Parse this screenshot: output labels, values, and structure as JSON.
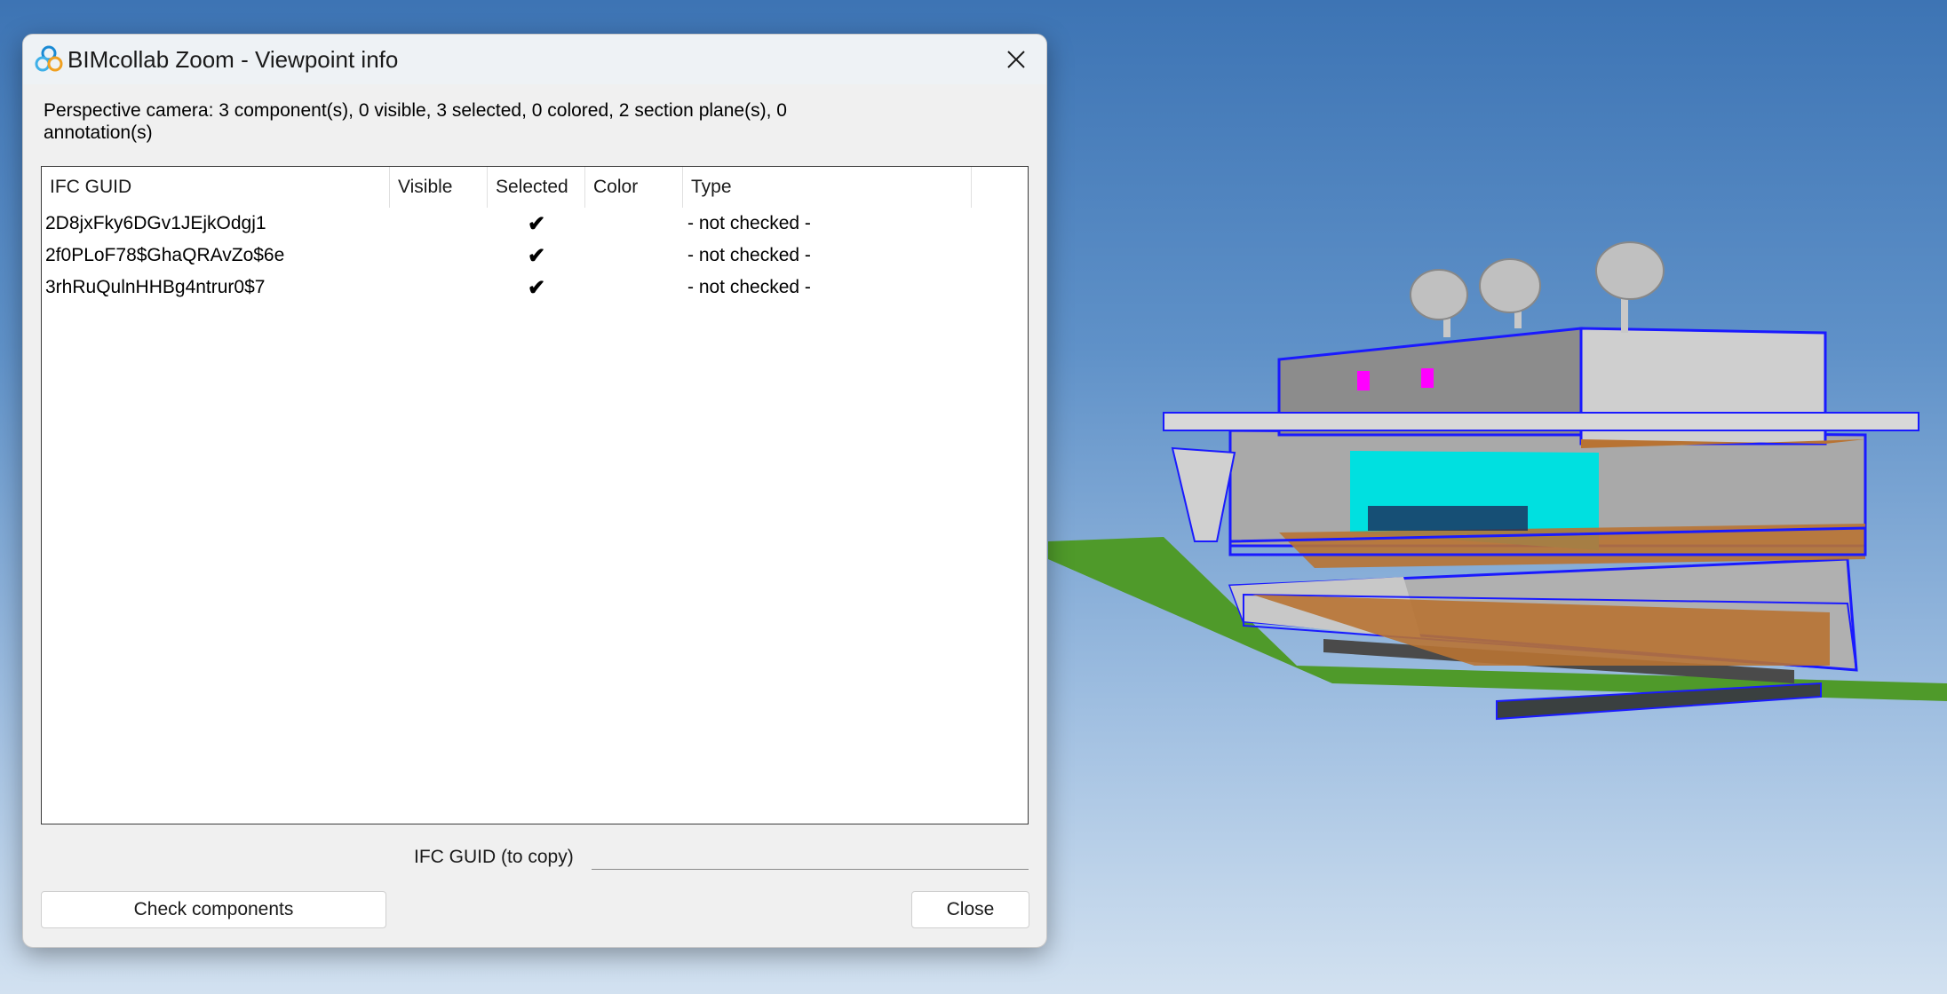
{
  "window": {
    "title": "BIMcollab Zoom - Viewpoint info",
    "icon": "bimcollab-logo-icon"
  },
  "summary": "Perspective camera: 3 component(s), 0 visible, 3 selected, 0 colored, 2 section plane(s), 0 annotation(s)",
  "table": {
    "headers": [
      "IFC GUID",
      "Visible",
      "Selected",
      "Color",
      "Type"
    ],
    "rows": [
      {
        "guid": "2D8jxFky6DGv1JEjkOdgj1",
        "visible": "",
        "selected": "✔",
        "color": "",
        "type": "- not checked -"
      },
      {
        "guid": "2f0PLoF78$GhaQRAvZo$6e",
        "visible": "",
        "selected": "✔",
        "color": "",
        "type": "- not checked -"
      },
      {
        "guid": "3rhRuQulnHHBg4ntrur0$7",
        "visible": "",
        "selected": "✔",
        "color": "",
        "type": "- not checked -"
      }
    ]
  },
  "copy": {
    "label": "IFC GUID (to copy)",
    "value": ""
  },
  "buttons": {
    "check_components": "Check components",
    "close": "Close"
  },
  "colors": {
    "selection_outline": "#1a1aff",
    "highlight": "#00e0e0",
    "ground": "#4f9a2a",
    "floor": "#b87333"
  }
}
